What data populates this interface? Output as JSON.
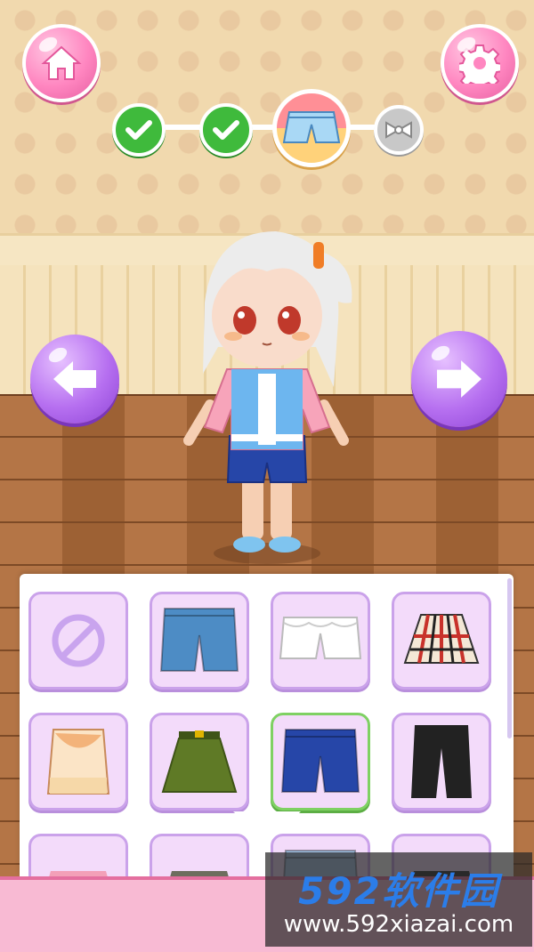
{
  "screen": "dress-up-bottoms",
  "top_bar": {
    "home_icon": "house-icon",
    "settings_icon": "gear-icon"
  },
  "progress": {
    "steps": [
      {
        "category": "top",
        "state": "done",
        "icon": "checkmark-icon"
      },
      {
        "category": "jacket",
        "state": "done",
        "icon": "checkmark-icon"
      },
      {
        "category": "bottoms",
        "state": "current",
        "icon": "shorts-icon"
      },
      {
        "category": "accessory",
        "state": "locked",
        "icon": "bow-icon"
      }
    ]
  },
  "navigation": {
    "prev_icon": "arrow-left-icon",
    "next_icon": "arrow-right-icon"
  },
  "wardrobe": {
    "selected_index": 6,
    "items": [
      {
        "name": "none",
        "icon": "no-item-icon"
      },
      {
        "name": "denim-shorts",
        "icon": "denim-shorts-icon",
        "color": "#4d8cc5"
      },
      {
        "name": "white-lace-shorts",
        "icon": "lace-shorts-icon",
        "color": "#ffffff"
      },
      {
        "name": "plaid-skirt",
        "icon": "plaid-skirt-icon",
        "color": "#c8322b"
      },
      {
        "name": "koi-print-skirt",
        "icon": "print-skirt-icon",
        "color": "#f3b37a"
      },
      {
        "name": "olive-skirt",
        "icon": "olive-skirt-icon",
        "color": "#5f7a26"
      },
      {
        "name": "navy-shorts",
        "icon": "navy-shorts-icon",
        "color": "#2646a8"
      },
      {
        "name": "black-pants",
        "icon": "black-pants-icon",
        "color": "#222222"
      },
      {
        "name": "pink-skirt",
        "icon": "skirt-icon",
        "color": "#f3a0b8"
      },
      {
        "name": "gray-skirt",
        "icon": "skirt-icon",
        "color": "#6d6d5e"
      },
      {
        "name": "light-shorts",
        "icon": "shorts-icon",
        "color": "#a9c9ec"
      },
      {
        "name": "dark-skirt",
        "icon": "skirt-icon",
        "color": "#2b2b2b"
      }
    ]
  },
  "watermark": {
    "title": "592软件园",
    "url": "www.592xiazai.com"
  },
  "colors": {
    "accent_pink": "#ff86c0",
    "accent_purple": "#b66ff0",
    "done_green": "#3fba3c"
  }
}
